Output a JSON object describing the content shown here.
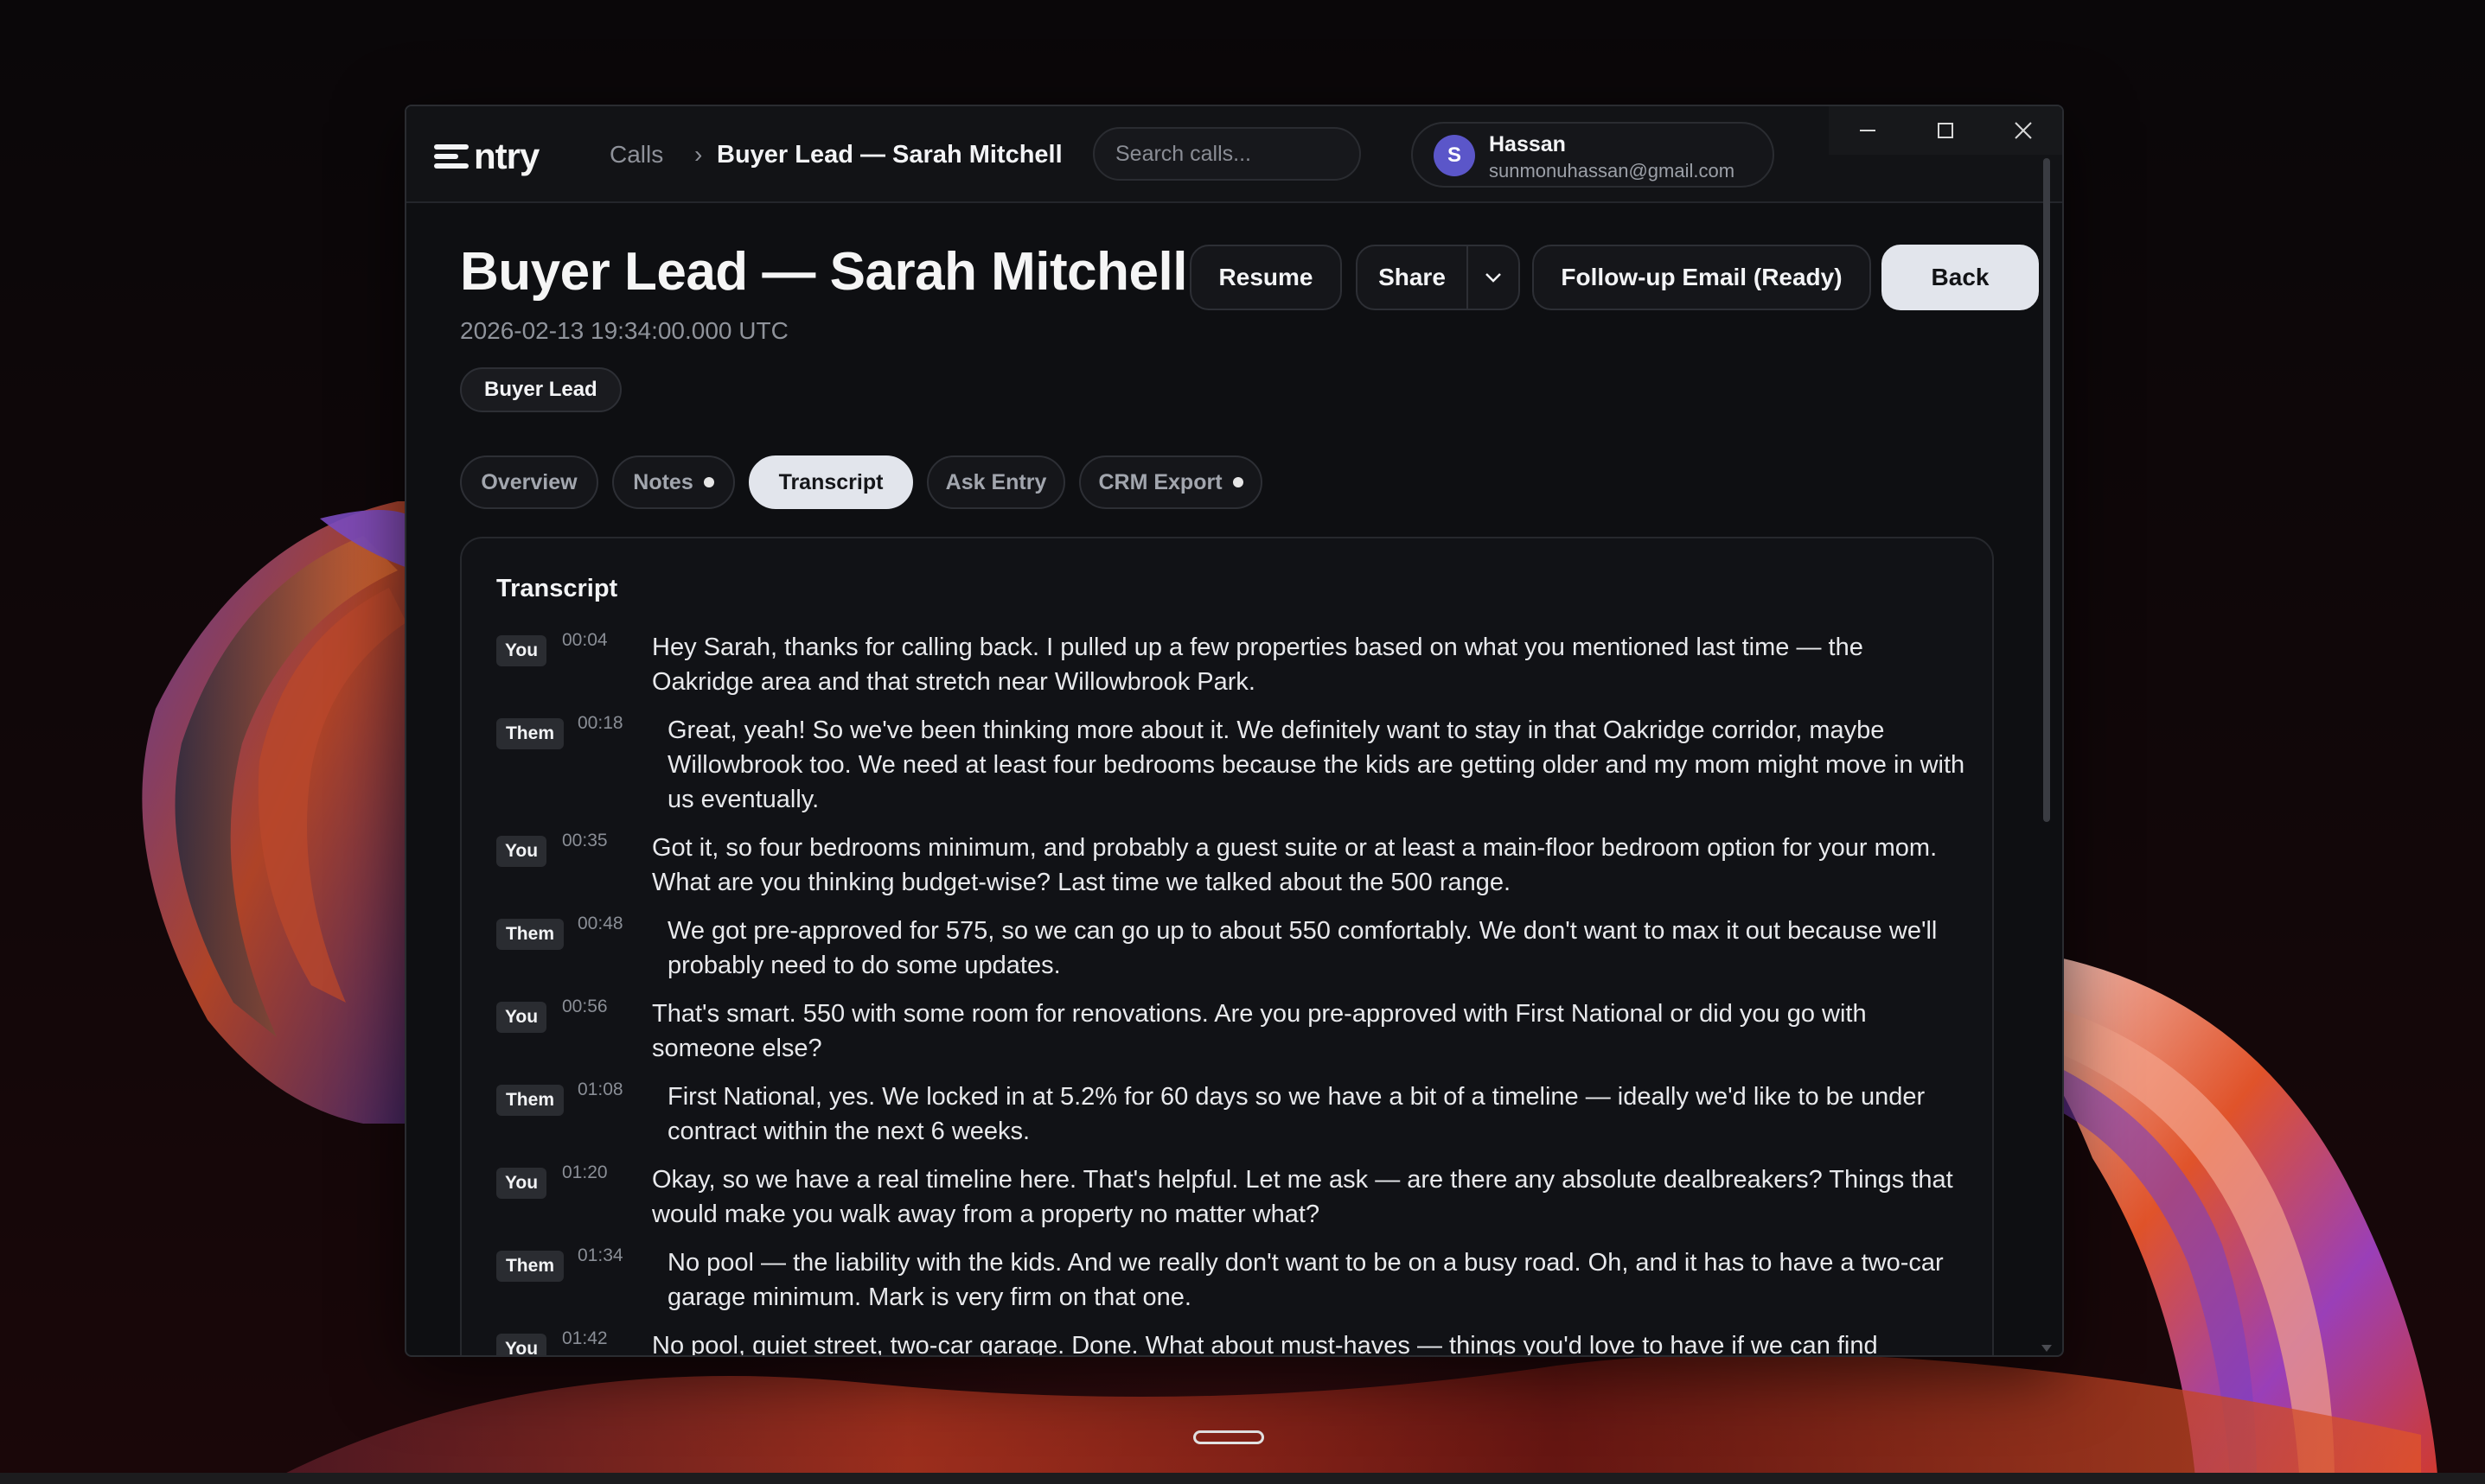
{
  "app": {
    "logo_text": "ntry",
    "breadcrumb": {
      "root": "Calls",
      "separator": "›",
      "current": "Buyer Lead — Sarah Mitchell"
    },
    "search": {
      "placeholder": "Search calls...",
      "value": ""
    },
    "user": {
      "initial": "S",
      "name": "Hassan",
      "email": "sunmonuhassan@gmail.com"
    }
  },
  "window_controls": {
    "minimize_icon": "minimize-icon",
    "maximize_icon": "maximize-icon",
    "close_icon": "close-icon"
  },
  "header": {
    "title": "Buyer Lead — Sarah Mitchell",
    "date": "2026-02-13 19:34:00.000 UTC",
    "tag": "Buyer Lead",
    "actions": {
      "resume": "Resume",
      "share": "Share",
      "share_caret_icon": "chevron-down-icon",
      "followup": "Follow-up Email (Ready)",
      "back": "Back"
    }
  },
  "tabs": [
    {
      "label": "Overview",
      "dot": false
    },
    {
      "label": "Notes",
      "dot": true
    },
    {
      "label": "Transcript",
      "dot": false,
      "active": true
    },
    {
      "label": "Ask Entry",
      "dot": false
    },
    {
      "label": "CRM Export",
      "dot": true
    }
  ],
  "transcript": {
    "title": "Transcript",
    "messages": [
      {
        "speaker": "You",
        "time": "00:04",
        "text": "Hey Sarah, thanks for calling back. I pulled up a few properties based on what you mentioned last time — the Oakridge area and that stretch near Willowbrook Park."
      },
      {
        "speaker": "Them",
        "time": "00:18",
        "text": "Great, yeah! So we've been thinking more about it. We definitely want to stay in that Oakridge corridor, maybe Willowbrook too. We need at least four bedrooms because the kids are getting older and my mom might move in with us eventually."
      },
      {
        "speaker": "You",
        "time": "00:35",
        "text": "Got it, so four bedrooms minimum, and probably a guest suite or at least a main-floor bedroom option for your mom. What are you thinking budget-wise? Last time we talked about the 500 range."
      },
      {
        "speaker": "Them",
        "time": "00:48",
        "text": "We got pre-approved for 575, so we can go up to about 550 comfortably. We don't want to max it out because we'll probably need to do some updates."
      },
      {
        "speaker": "You",
        "time": "00:56",
        "text": "That's smart. 550 with some room for renovations. Are you pre-approved with First National or did you go with someone else?"
      },
      {
        "speaker": "Them",
        "time": "01:08",
        "text": "First National, yes. We locked in at 5.2% for 60 days so we have a bit of a timeline — ideally we'd like to be under contract within the next 6 weeks."
      },
      {
        "speaker": "You",
        "time": "01:20",
        "text": "Okay, so we have a real timeline here. That's helpful. Let me ask — are there any absolute dealbreakers? Things that would make you walk away from a property no matter what?"
      },
      {
        "speaker": "Them",
        "time": "01:34",
        "text": "No pool — the liability with the kids. And we really don't want to be on a busy road. Oh, and it has to have a two-car garage minimum. Mark is very firm on that one."
      },
      {
        "speaker": "You",
        "time": "01:42",
        "text": "No pool, quiet street, two-car garage. Done. What about must-haves — things you'd love to have if we can find"
      }
    ]
  }
}
